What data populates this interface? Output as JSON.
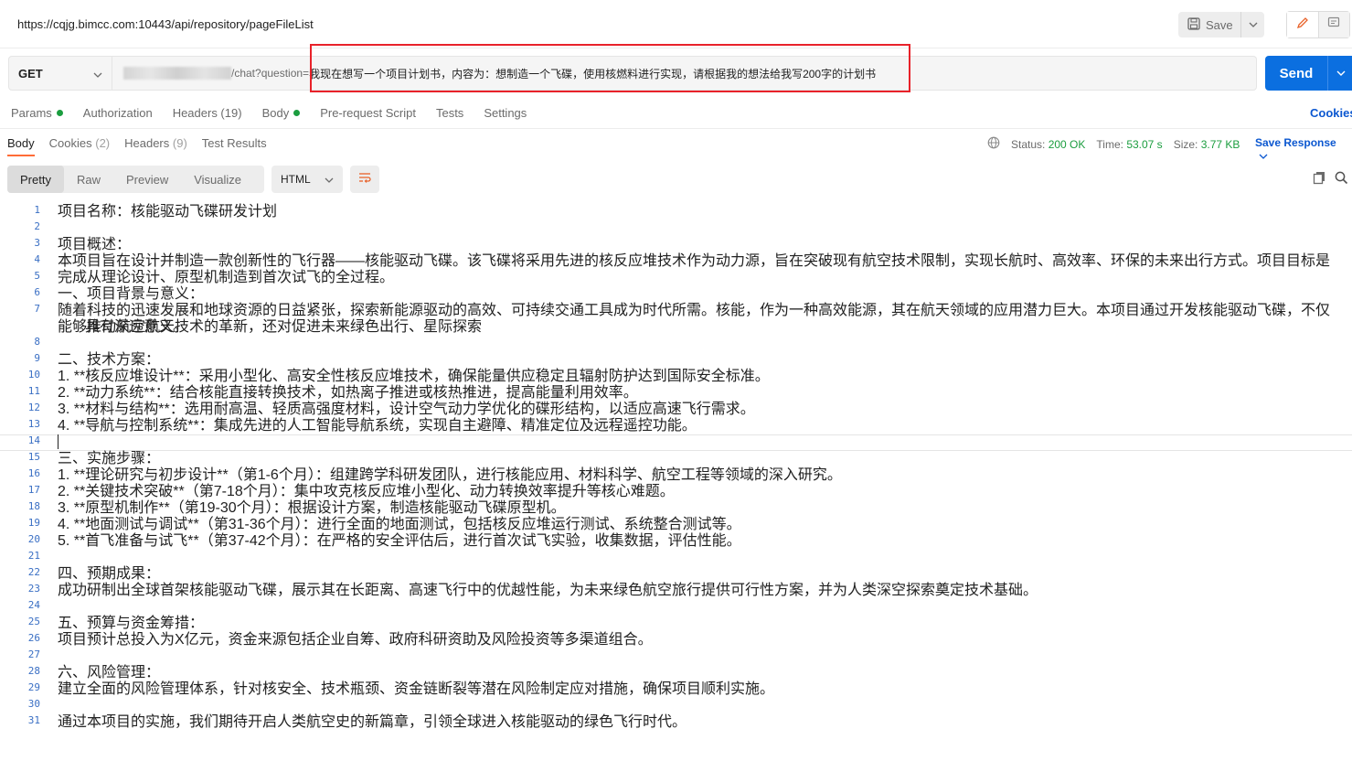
{
  "header": {
    "url": "https://cqjg.bimcc.com:10443/api/repository/pageFileList",
    "save_label": "Save"
  },
  "request": {
    "method": "GET",
    "url_path": "/chat?question=",
    "url_query": "我现在想写一个项目计划书，内容为：想制造一个飞碟，使用核燃料进行实现，请根据我的想法给我写200字的计划书",
    "send_label": "Send"
  },
  "request_tabs": [
    {
      "label": "Params",
      "dot": true
    },
    {
      "label": "Authorization",
      "dot": false
    },
    {
      "label": "Headers (19)",
      "dot": false
    },
    {
      "label": "Body",
      "dot": true
    },
    {
      "label": "Pre-request Script",
      "dot": false
    },
    {
      "label": "Tests",
      "dot": false
    },
    {
      "label": "Settings",
      "dot": false
    }
  ],
  "cookies_link": "Cookies",
  "response_tabs": {
    "body": "Body",
    "cookies": "Cookies",
    "cookies_count": "(2)",
    "headers": "Headers",
    "headers_count": "(9)",
    "test_results": "Test Results"
  },
  "status": {
    "status_label": "Status:",
    "status_value": "200 OK",
    "time_label": "Time:",
    "time_value": "53.07 s",
    "size_label": "Size:",
    "size_value": "3.77 KB",
    "save_response": "Save Response"
  },
  "view_modes": [
    "Pretty",
    "Raw",
    "Preview",
    "Visualize"
  ],
  "format": "HTML",
  "lines": [
    "项目名称：核能驱动飞碟研发计划",
    "",
    "项目概述：",
    "本项目旨在设计并制造一款创新性的飞行器——核能驱动飞碟。该飞碟将采用先进的核反应堆技术作为动力源，旨在突破现有航空技术限制，实现长航时、高效率、环保的未来出行方式。项目目标是完成从理论设计、原型机制造到首次试飞的全过程。",
    "",
    "一、项目背景与意义：",
    "随着科技的迅速发展和地球资源的日益紧张，探索新能源驱动的高效、可持续交通工具成为时代所需。核能，作为一种高效能源，其在航天领域的应用潜力巨大。本项目通过开发核能驱动飞碟，不仅能够推动航空航天技术的革新，还对促进未来绿色出行、星际探索具有深远意义。",
    "",
    "二、技术方案：",
    "1. **核反应堆设计**：采用小型化、高安全性核反应堆技术，确保能量供应稳定且辐射防护达到国际安全标准。",
    "2. **动力系统**：结合核能直接转换技术，如热离子推进或核热推进，提高能量利用效率。",
    "3. **材料与结构**：选用耐高温、轻质高强度材料，设计空气动力学优化的碟形结构，以适应高速飞行需求。",
    "4. **导航与控制系统**：集成先进的人工智能导航系统，实现自主避障、精准定位及远程遥控功能。",
    "",
    "三、实施步骤：",
    "1. **理论研究与初步设计**（第1-6个月）：组建跨学科研发团队，进行核能应用、材料科学、航空工程等领域的深入研究。",
    "2. **关键技术突破**（第7-18个月）：集中攻克核反应堆小型化、动力转换效率提升等核心难题。",
    "3. **原型机制作**（第19-30个月）：根据设计方案，制造核能驱动飞碟原型机。",
    "4. **地面测试与调试**（第31-36个月）：进行全面的地面测试，包括核反应堆运行测试、系统整合测试等。",
    "5. **首飞准备与试飞**（第37-42个月）：在严格的安全评估后，进行首次试飞实验，收集数据，评估性能。",
    "",
    "四、预期成果：",
    "成功研制出全球首架核能驱动飞碟，展示其在长距离、高速飞行中的优越性能，为未来绿色航空旅行提供可行性方案，并为人类深空探索奠定技术基础。",
    "",
    "五、预算与资金筹措：",
    "项目预计总投入为X亿元，资金来源包括企业自筹、政府科研资助及风险投资等多渠道组合。",
    "",
    "六、风险管理：",
    "建立全面的风险管理体系，针对核安全、技术瓶颈、资金链断裂等潜在风险制定应对措施，确保项目顺利实施。",
    "",
    "通过本项目的实施，我们期待开启人类航空史的新篇章，引领全球进入核能驱动的绿色飞行时代。"
  ],
  "line7_cont": "具有深远意义。"
}
